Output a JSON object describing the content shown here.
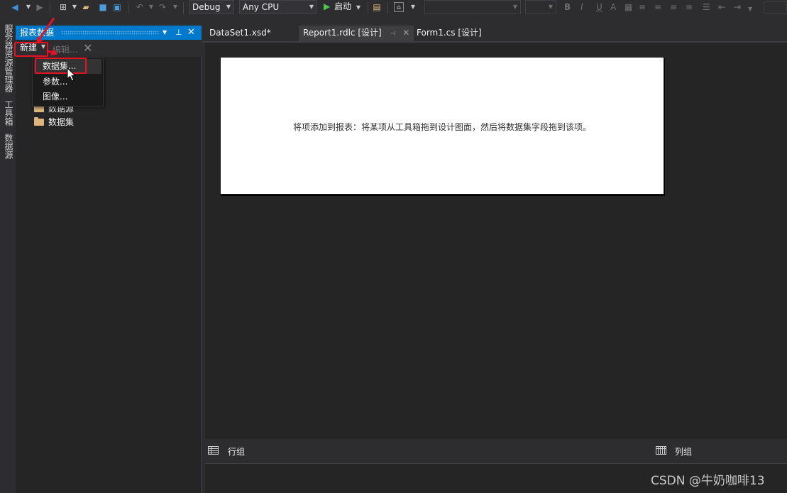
{
  "toolbar": {
    "config": "Debug",
    "platform": "Any CPU",
    "start_label": "启动",
    "format_buttons": [
      "B",
      "I",
      "U",
      "A"
    ]
  },
  "left_strip": {
    "tabs": [
      "服务器资源管理器",
      "工具箱",
      "数据源"
    ]
  },
  "panel": {
    "title": "报表数据",
    "new_label": "新建",
    "edit_label": "编辑...",
    "tree": [
      {
        "label": "数据源"
      },
      {
        "label": "数据集"
      }
    ]
  },
  "menu": {
    "items": [
      {
        "label": "数据集..."
      },
      {
        "label": "参数..."
      },
      {
        "label": "图像..."
      }
    ]
  },
  "tabs": [
    {
      "label": "DataSet1.xsd*"
    },
    {
      "label": "Report1.rdlc [设计]"
    },
    {
      "label": "Form1.cs [设计]"
    }
  ],
  "report": {
    "hint": "将项添加到报表：将某项从工具箱拖到设计图面，然后将数据集字段拖到该项。"
  },
  "grouping": {
    "row_groups": "行组",
    "column_groups": "列组"
  },
  "watermark": "CSDN @牛奶咖啡13",
  "colors": {
    "accent": "#007acc",
    "annotation": "#e81123",
    "background": "#2d2d30"
  }
}
